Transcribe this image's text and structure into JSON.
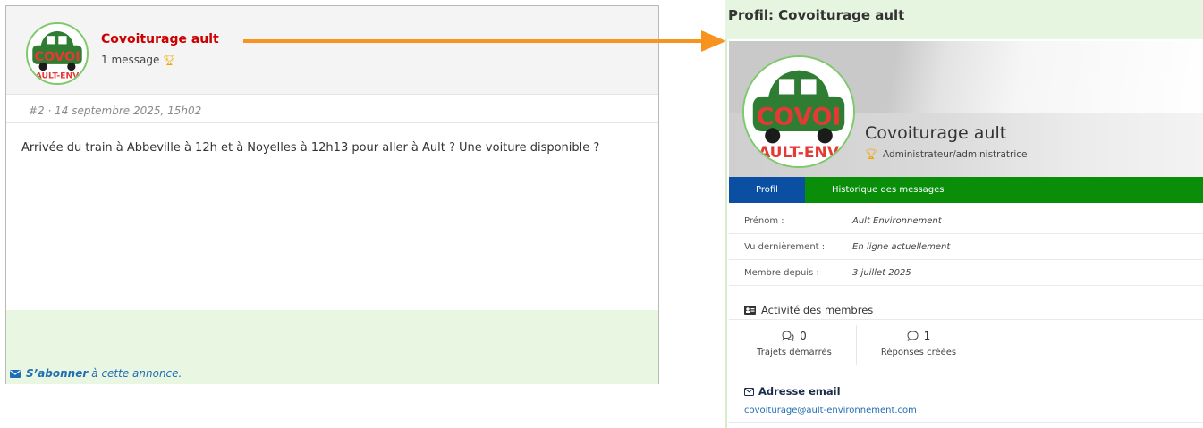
{
  "post": {
    "author_name": "Covoiturage ault",
    "message_count": "1 message",
    "date": "#2 · 14 septembre 2025, 15h02",
    "body": "Arrivée du train à Abbeville à 12h et à Noyelles à 12h13 pour aller à Ault ? Une voiture disponible ?",
    "subscribe_bold": "S’abonner",
    "subscribe_rest": "à cette annonce."
  },
  "profile": {
    "title": "Profil: Covoiturage ault",
    "name": "Covoiturage ault",
    "role": "Administrateur/administratrice",
    "tabs": [
      {
        "label": "Profil"
      },
      {
        "label": "Historique des messages"
      }
    ],
    "fields": [
      {
        "label": "Prénom :",
        "value": "Ault Environnement"
      },
      {
        "label": "Vu dernièrement :",
        "value": "En ligne actuellement"
      },
      {
        "label": "Membre depuis :",
        "value": "3 juillet 2025"
      }
    ],
    "activity_heading": "Activité des membres",
    "stats": [
      {
        "value": "0",
        "label": "Trajets démarrés"
      },
      {
        "value": "1",
        "label": "Réponses créées"
      }
    ],
    "email_heading": "Adresse email",
    "email": "covoiturage@ault-environnement.com"
  },
  "avatar_text": {
    "top": "COVOI",
    "bottom": "AULT-ENV"
  },
  "colors": {
    "author_red": "#cc0000",
    "tab_green": "#0a8e0a",
    "tab_active_blue": "#0b4fa2",
    "arrow_orange": "#f7931e",
    "light_green_bg": "#e6f5df",
    "link_blue": "#1f6db3"
  },
  "icons": [
    "trophy-icon",
    "envelope-icon",
    "id-card-icon",
    "chat-bubbles-icon",
    "chat-bubble-icon",
    "envelope-outline-icon",
    "car-logo-icon"
  ]
}
